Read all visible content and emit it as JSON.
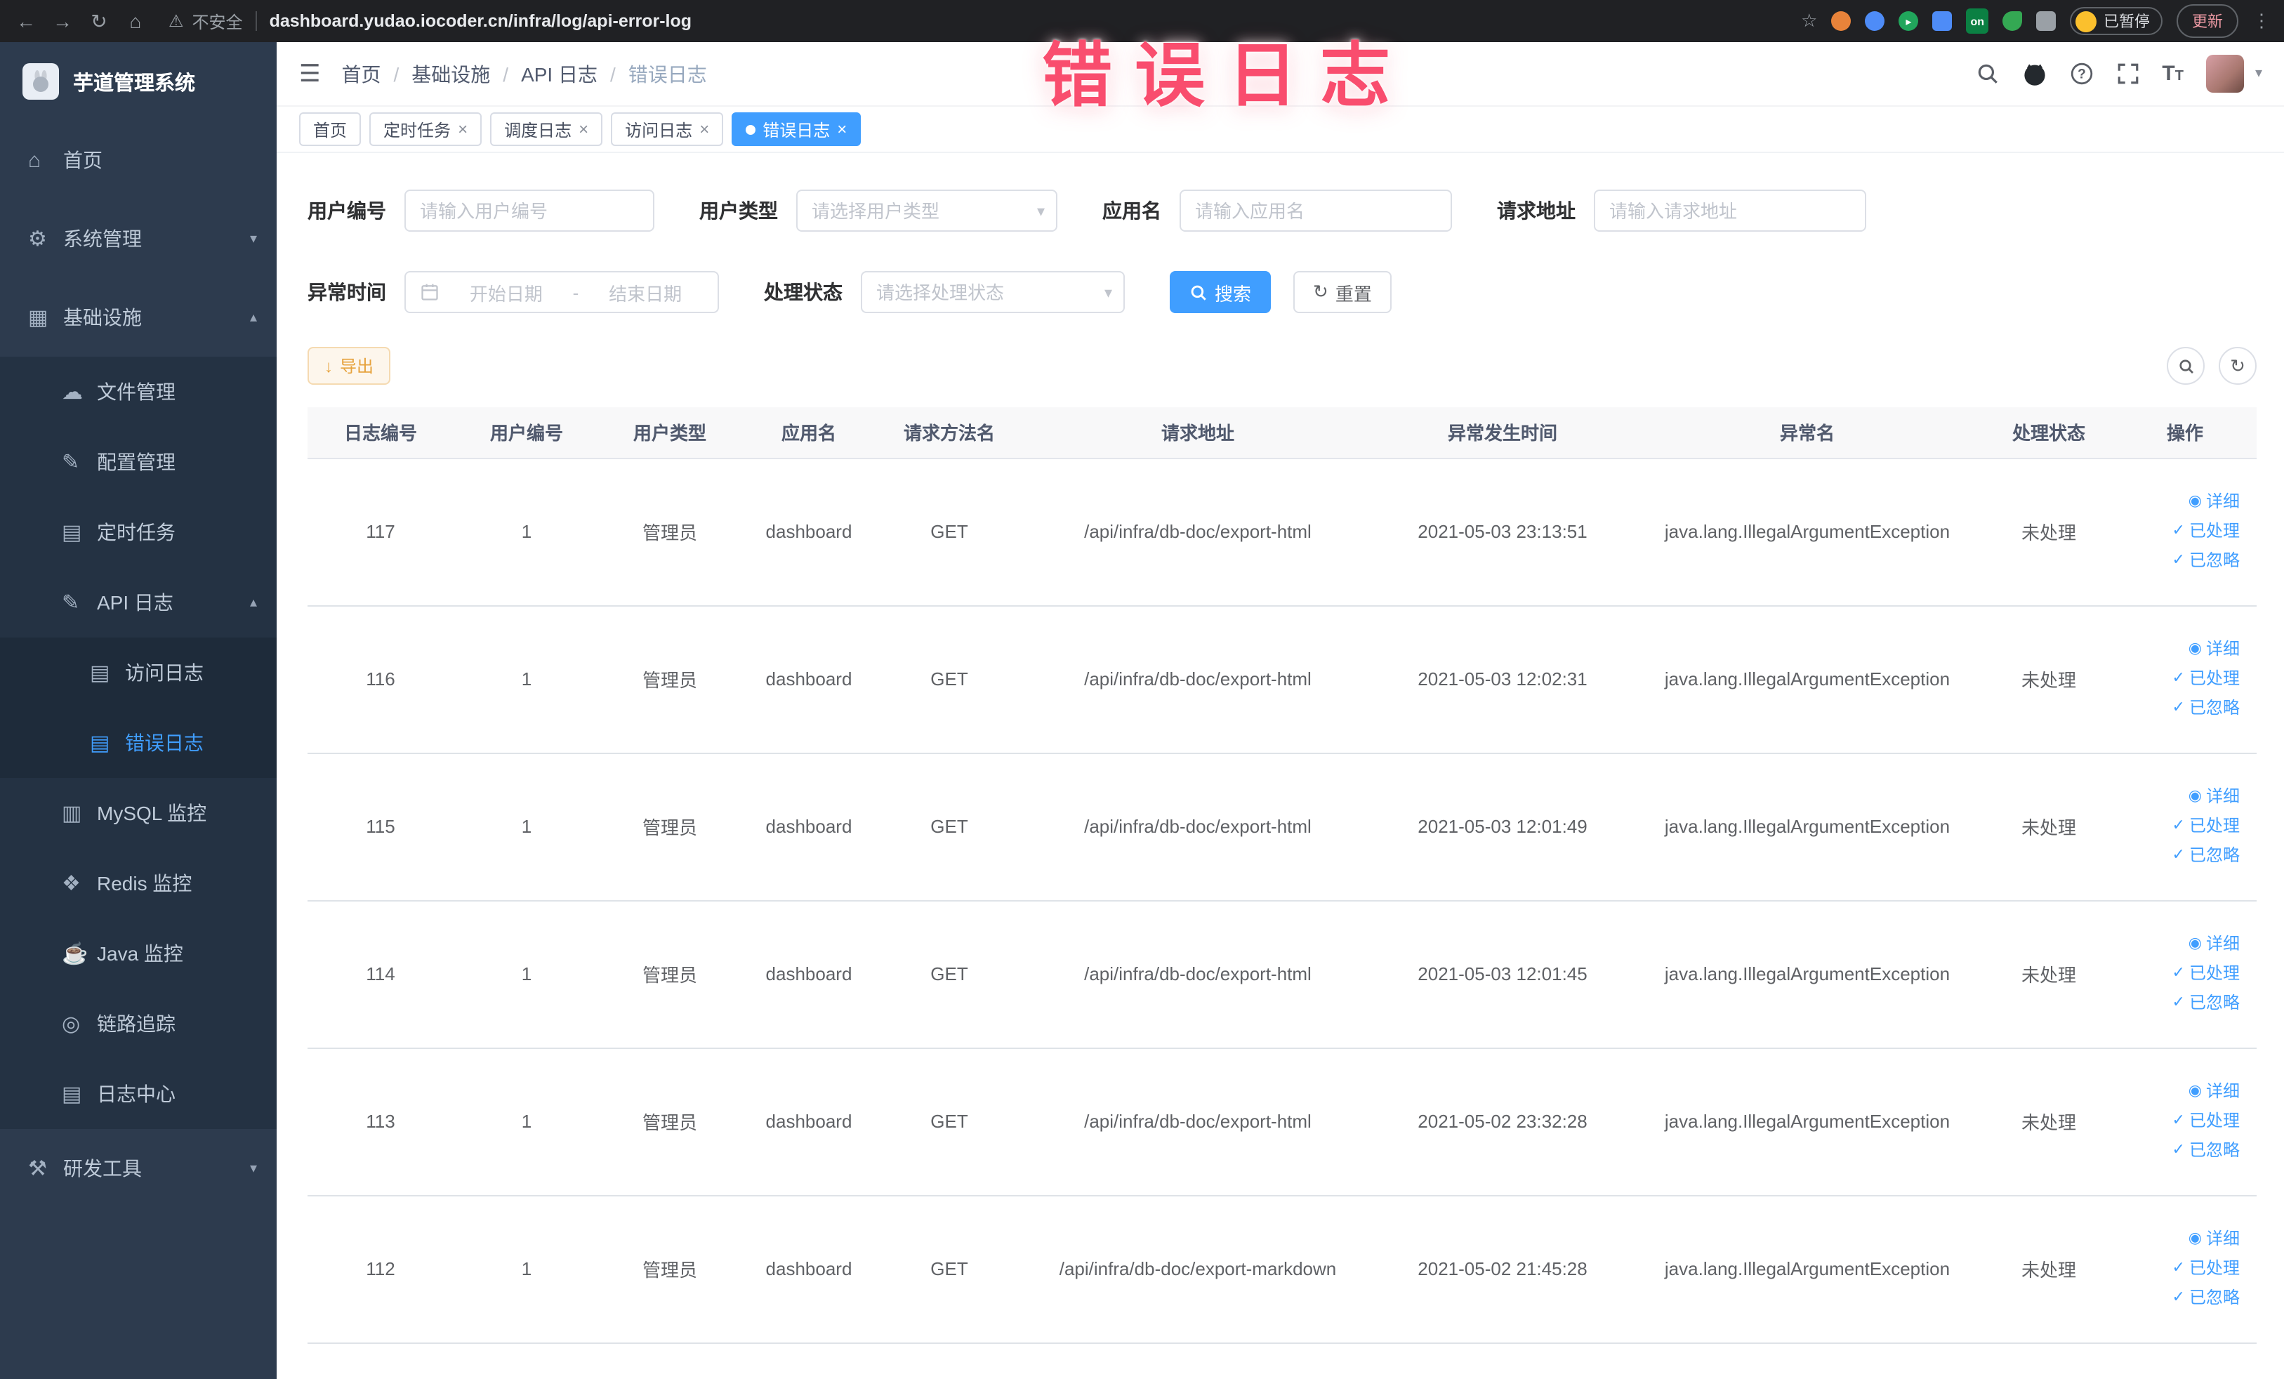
{
  "browser": {
    "security_warning": "不安全",
    "url": "dashboard.yudao.iocoder.cn/infra/log/api-error-log",
    "paused_badge": "已暂停",
    "update_label": "更新"
  },
  "overlay_title": "错误日志",
  "icons": {
    "back": "←",
    "forward": "→",
    "reload": "↻",
    "home": "⌂",
    "warning": "⚠",
    "star": "☆",
    "kebab": "⋮",
    "on_badge": "on",
    "play": "▸",
    "hamburger": "☰",
    "breadcrumb_sep": "/",
    "caret_down": "▾",
    "caret_up": "▴",
    "close": "×",
    "download": "↓",
    "refresh": "↻",
    "eye": "◉",
    "check": "✓"
  },
  "sidebar": {
    "logo_title": "芋道管理系统",
    "icons": {
      "home": "⌂",
      "system": "⚙",
      "infra": "▦",
      "file": "☁",
      "config": "✎",
      "job": "▤",
      "api_log": "✎",
      "access_log": "▤",
      "error_log": "▤",
      "mysql": "▥",
      "redis": "❖",
      "java": "☕",
      "trace": "◎",
      "log_center": "▤",
      "dev_tools": "⚒"
    },
    "items": {
      "home": {
        "label": "首页"
      },
      "system": {
        "label": "系统管理"
      },
      "infra": {
        "label": "基础设施"
      },
      "file": {
        "label": "文件管理"
      },
      "config": {
        "label": "配置管理"
      },
      "job": {
        "label": "定时任务"
      },
      "api_log": {
        "label": "API 日志"
      },
      "access_log": {
        "label": "访问日志"
      },
      "error_log": {
        "label": "错误日志"
      },
      "mysql": {
        "label": "MySQL 监控"
      },
      "redis": {
        "label": "Redis 监控"
      },
      "java": {
        "label": "Java 监控"
      },
      "trace": {
        "label": "链路追踪"
      },
      "log_center": {
        "label": "日志中心"
      },
      "dev_tools": {
        "label": "研发工具"
      }
    }
  },
  "breadcrumb": {
    "items": [
      "首页",
      "基础设施",
      "API 日志",
      "错误日志"
    ]
  },
  "tabs": {
    "items": [
      {
        "label": "首页"
      },
      {
        "label": "定时任务"
      },
      {
        "label": "调度日志"
      },
      {
        "label": "访问日志"
      },
      {
        "label": "错误日志"
      }
    ]
  },
  "filters": {
    "user_id": {
      "label": "用户编号",
      "placeholder": "请输入用户编号"
    },
    "user_type": {
      "label": "用户类型",
      "placeholder": "请选择用户类型"
    },
    "app_name": {
      "label": "应用名",
      "placeholder": "请输入应用名"
    },
    "request_url": {
      "label": "请求地址",
      "placeholder": "请输入请求地址"
    },
    "exception_time": {
      "label": "异常时间",
      "start_placeholder": "开始日期",
      "separator": "-",
      "end_placeholder": "结束日期"
    },
    "process_status": {
      "label": "处理状态",
      "placeholder": "请选择处理状态"
    },
    "search_label": "搜索",
    "reset_label": "重置"
  },
  "toolbar": {
    "export_label": "导出"
  },
  "table": {
    "columns": [
      "日志编号",
      "用户编号",
      "用户类型",
      "应用名",
      "请求方法名",
      "请求地址",
      "异常发生时间",
      "异常名",
      "处理状态",
      "操作"
    ],
    "actions": [
      "详细",
      "已处理",
      "已忽略"
    ],
    "rows": [
      {
        "id": "117",
        "user_id": "1",
        "user_type": "管理员",
        "app": "dashboard",
        "method": "GET",
        "url": "/api/infra/db-doc/export-html",
        "time": "2021-05-03 23:13:51",
        "exception": "java.lang.IllegalArgumentException",
        "status": "未处理"
      },
      {
        "id": "116",
        "user_id": "1",
        "user_type": "管理员",
        "app": "dashboard",
        "method": "GET",
        "url": "/api/infra/db-doc/export-html",
        "time": "2021-05-03 12:02:31",
        "exception": "java.lang.IllegalArgumentException",
        "status": "未处理"
      },
      {
        "id": "115",
        "user_id": "1",
        "user_type": "管理员",
        "app": "dashboard",
        "method": "GET",
        "url": "/api/infra/db-doc/export-html",
        "time": "2021-05-03 12:01:49",
        "exception": "java.lang.IllegalArgumentException",
        "status": "未处理"
      },
      {
        "id": "114",
        "user_id": "1",
        "user_type": "管理员",
        "app": "dashboard",
        "method": "GET",
        "url": "/api/infra/db-doc/export-html",
        "time": "2021-05-03 12:01:45",
        "exception": "java.lang.IllegalArgumentException",
        "status": "未处理"
      },
      {
        "id": "113",
        "user_id": "1",
        "user_type": "管理员",
        "app": "dashboard",
        "method": "GET",
        "url": "/api/infra/db-doc/export-html",
        "time": "2021-05-02 23:32:28",
        "exception": "java.lang.IllegalArgumentException",
        "status": "未处理"
      },
      {
        "id": "112",
        "user_id": "1",
        "user_type": "管理员",
        "app": "dashboard",
        "method": "GET",
        "url": "/api/infra/db-doc/export-markdown",
        "time": "2021-05-02 21:45:28",
        "exception": "java.lang.IllegalArgumentException",
        "status": "未处理"
      }
    ]
  }
}
